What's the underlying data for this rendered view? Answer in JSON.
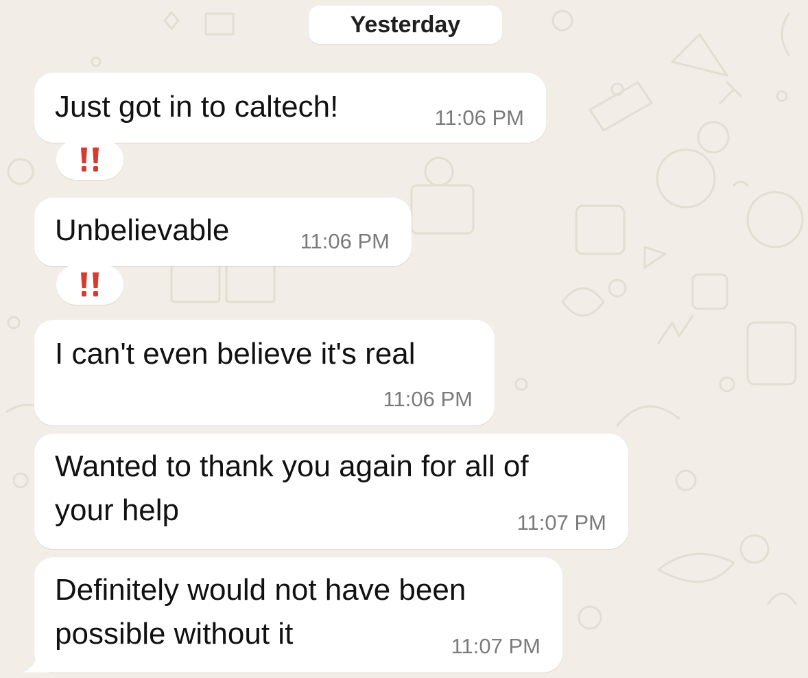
{
  "chat": {
    "date_separator": "Yesterday",
    "messages": [
      {
        "text": "Just got in to caltech!",
        "time": "11:06 PM",
        "reaction": "‼"
      },
      {
        "text": "Unbelievable",
        "time": "11:06 PM",
        "reaction": "‼"
      },
      {
        "text": "I can't even believe it's real",
        "time": "11:06 PM"
      },
      {
        "text": "Wanted to thank you again for all of\nyour help",
        "time": "11:07 PM"
      },
      {
        "text": "Definitely would not have been\npossible without it",
        "time": "11:07 PM"
      }
    ]
  },
  "colors": {
    "wallpaper": "#f2eee7",
    "bubble": "#ffffff",
    "reaction_red": "#d83a2f",
    "timestamp": "#7b7b7b"
  },
  "icons": {
    "reaction": "double-exclamation-icon",
    "wallpaper_doodles": "doodle-pattern"
  }
}
